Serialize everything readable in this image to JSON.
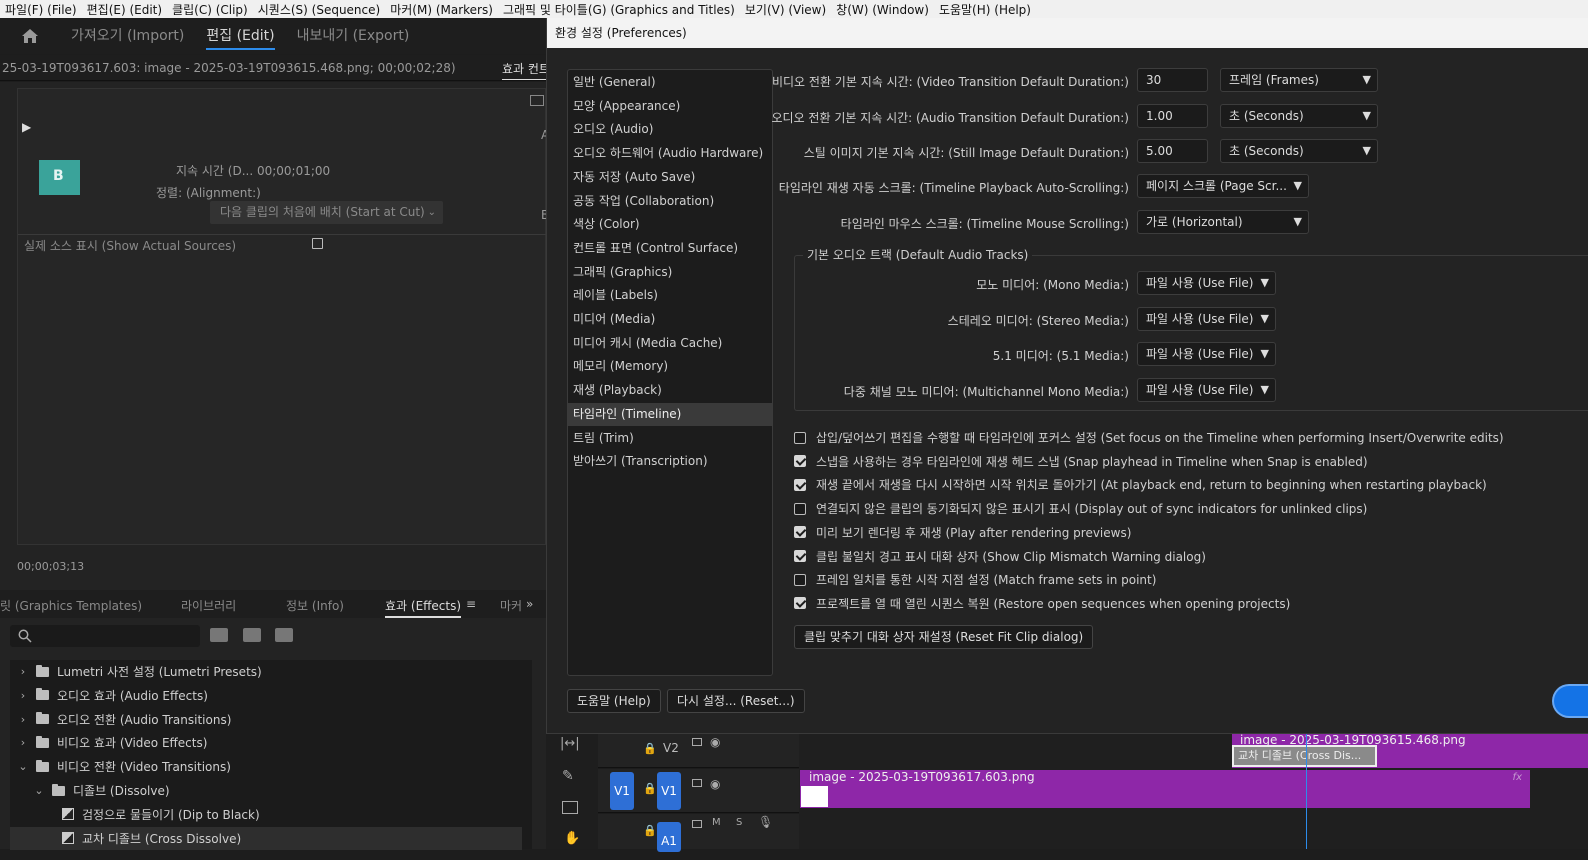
{
  "menubar": [
    "파일(F) (File)",
    "편집(E) (Edit)",
    "클립(C) (Clip)",
    "시퀀스(S) (Sequence)",
    "마커(M) (Markers)",
    "그래픽 및 타이틀(G) (Graphics and Titles)",
    "보기(V) (View)",
    "창(W) (Window)",
    "도움말(H) (Help)"
  ],
  "workspace": {
    "import": "가져오기 (Import)",
    "edit": "편집 (Edit)",
    "export": "내보내기 (Export)"
  },
  "source": {
    "title": "25-03-19T093617.603: image - 2025-03-19T093615.468.png; 00;00;02;28)",
    "effects_controls_tab": "효과 컨트",
    "duration": "지속 시간 (D... 00;00;01;00",
    "alignment_label": "정렬: (Alignment:)",
    "alignment_value": "다음 클립의 처음에 배치 (Start at Cut)",
    "show_actual_sources": "실제 소스 표시 (Show Actual Sources)",
    "timecode": "00;00;03;13",
    "side_a": "A",
    "side_b": "B"
  },
  "fxtabs": {
    "graphics_templates": "릿 (Graphics Templates)",
    "libraries": "라이브러리",
    "info": "정보 (Info)",
    "effects": "효과 (Effects)",
    "markers": "마커"
  },
  "fxtree": [
    {
      "label": "Lumetri 사전 설정 (Lumetri Presets)",
      "level": 0,
      "open": false
    },
    {
      "label": "오디오 효과 (Audio Effects)",
      "level": 0,
      "open": false
    },
    {
      "label": "오디오 전환 (Audio Transitions)",
      "level": 0,
      "open": false
    },
    {
      "label": "비디오 효과 (Video Effects)",
      "level": 0,
      "open": false
    },
    {
      "label": "비디오 전환 (Video Transitions)",
      "level": 0,
      "open": true
    },
    {
      "label": "디졸브 (Dissolve)",
      "level": 1,
      "open": true
    },
    {
      "label": "검정으로 물들이기 (Dip to Black)",
      "level": 2,
      "open": false
    },
    {
      "label": "교차 디졸브 (Cross Dissolve)",
      "level": 2,
      "open": false
    }
  ],
  "dialog": {
    "title": "환경 설정 (Preferences)",
    "categories": [
      "일반 (General)",
      "모양 (Appearance)",
      "오디오 (Audio)",
      "오디오 하드웨어 (Audio Hardware)",
      "자동 저장 (Auto Save)",
      "공동 작업 (Collaboration)",
      "색상 (Color)",
      "컨트롤 표면 (Control Surface)",
      "그래픽 (Graphics)",
      "레이블 (Labels)",
      "미디어 (Media)",
      "미디어 캐시 (Media Cache)",
      "메모리 (Memory)",
      "재생 (Playback)",
      "타임라인 (Timeline)",
      "트림 (Trim)",
      "받아쓰기 (Transcription)"
    ],
    "selected_category": "타임라인 (Timeline)",
    "video_transition_label": "비디오 전환 기본 지속 시간: (Video Transition Default Duration:)",
    "video_transition_value": "30",
    "video_transition_unit": "프레임 (Frames)",
    "audio_transition_label": "오디오 전환 기본 지속 시간: (Audio Transition Default Duration:)",
    "audio_transition_value": "1.00",
    "audio_transition_unit": "초 (Seconds)",
    "still_image_label": "스틸 이미지 기본 지속 시간: (Still Image Default Duration:)",
    "still_image_value": "5.00",
    "still_image_unit": "초 (Seconds)",
    "playback_scroll_label": "타임라인 재생 자동 스크롤: (Timeline Playback Auto-Scrolling:)",
    "playback_scroll_value": "페이지 스크롤 (Page Scr...",
    "mouse_scroll_label": "타임라인 마우스 스크롤: (Timeline Mouse Scrolling:)",
    "mouse_scroll_value": "가로 (Horizontal)",
    "audio_tracks_group": "기본 오디오 트랙 (Default Audio Tracks)",
    "mono_label": "모노 미디어: (Mono Media:)",
    "mono_value": "파일 사용 (Use File)",
    "stereo_label": "스테레오 미디어: (Stereo Media:)",
    "stereo_value": "파일 사용 (Use File)",
    "five_one_label": "5.1 미디어: (5.1 Media:)",
    "five_one_value": "파일 사용 (Use File)",
    "multichannel_label": "다중 채널 모노 미디어: (Multichannel Mono Media:)",
    "multichannel_value": "파일 사용 (Use File)",
    "checkboxes": [
      {
        "label": "삽입/덮어쓰기 편집을 수행할 때 타임라인에 포커스 설정 (Set focus on the Timeline when performing Insert/Overwrite edits)",
        "checked": false
      },
      {
        "label": "스냅을 사용하는 경우 타임라인에 재생 헤드 스냅 (Snap playhead in Timeline when Snap is enabled)",
        "checked": true
      },
      {
        "label": "재생 끝에서 재생을 다시 시작하면 시작 위치로 돌아가기 (At playback end, return to beginning when restarting playback)",
        "checked": true
      },
      {
        "label": "연결되지 않은 클립의 동기화되지 않은 표시기 표시 (Display out of sync indicators for unlinked clips)",
        "checked": false
      },
      {
        "label": "미리 보기 렌더링 후 재생 (Play after rendering previews)",
        "checked": true
      },
      {
        "label": "클립 불일치 경고 표시 대화 상자 (Show Clip Mismatch Warning dialog)",
        "checked": true
      },
      {
        "label": "프레임 일치를 통한 시작 지점 설정 (Match frame sets in point)",
        "checked": false
      },
      {
        "label": "프로젝트를 열 때 열린 시퀀스 복원 (Restore open sequences when opening projects)",
        "checked": true
      }
    ],
    "reset_fit_clip": "클립 맞추기 대화 상자 재설정 (Reset Fit Clip dialog)",
    "help": "도움말 (Help)",
    "reset": "다시 설정... (Reset...)"
  },
  "timeline": {
    "v2": "V2",
    "v1": "V1",
    "a1": "A1",
    "m": "M",
    "s": "S",
    "clip_v2": "image - 2025-03-19T093615.468.png",
    "transition": "교차 디졸브 (Cross Dis...",
    "clip_v1": "image - 2025-03-19T093617.603.png",
    "fx": "fx"
  },
  "colors": {
    "accent": "#2d8ceb",
    "clip": "#8e27a8",
    "track_target": "#2e6fd6"
  }
}
